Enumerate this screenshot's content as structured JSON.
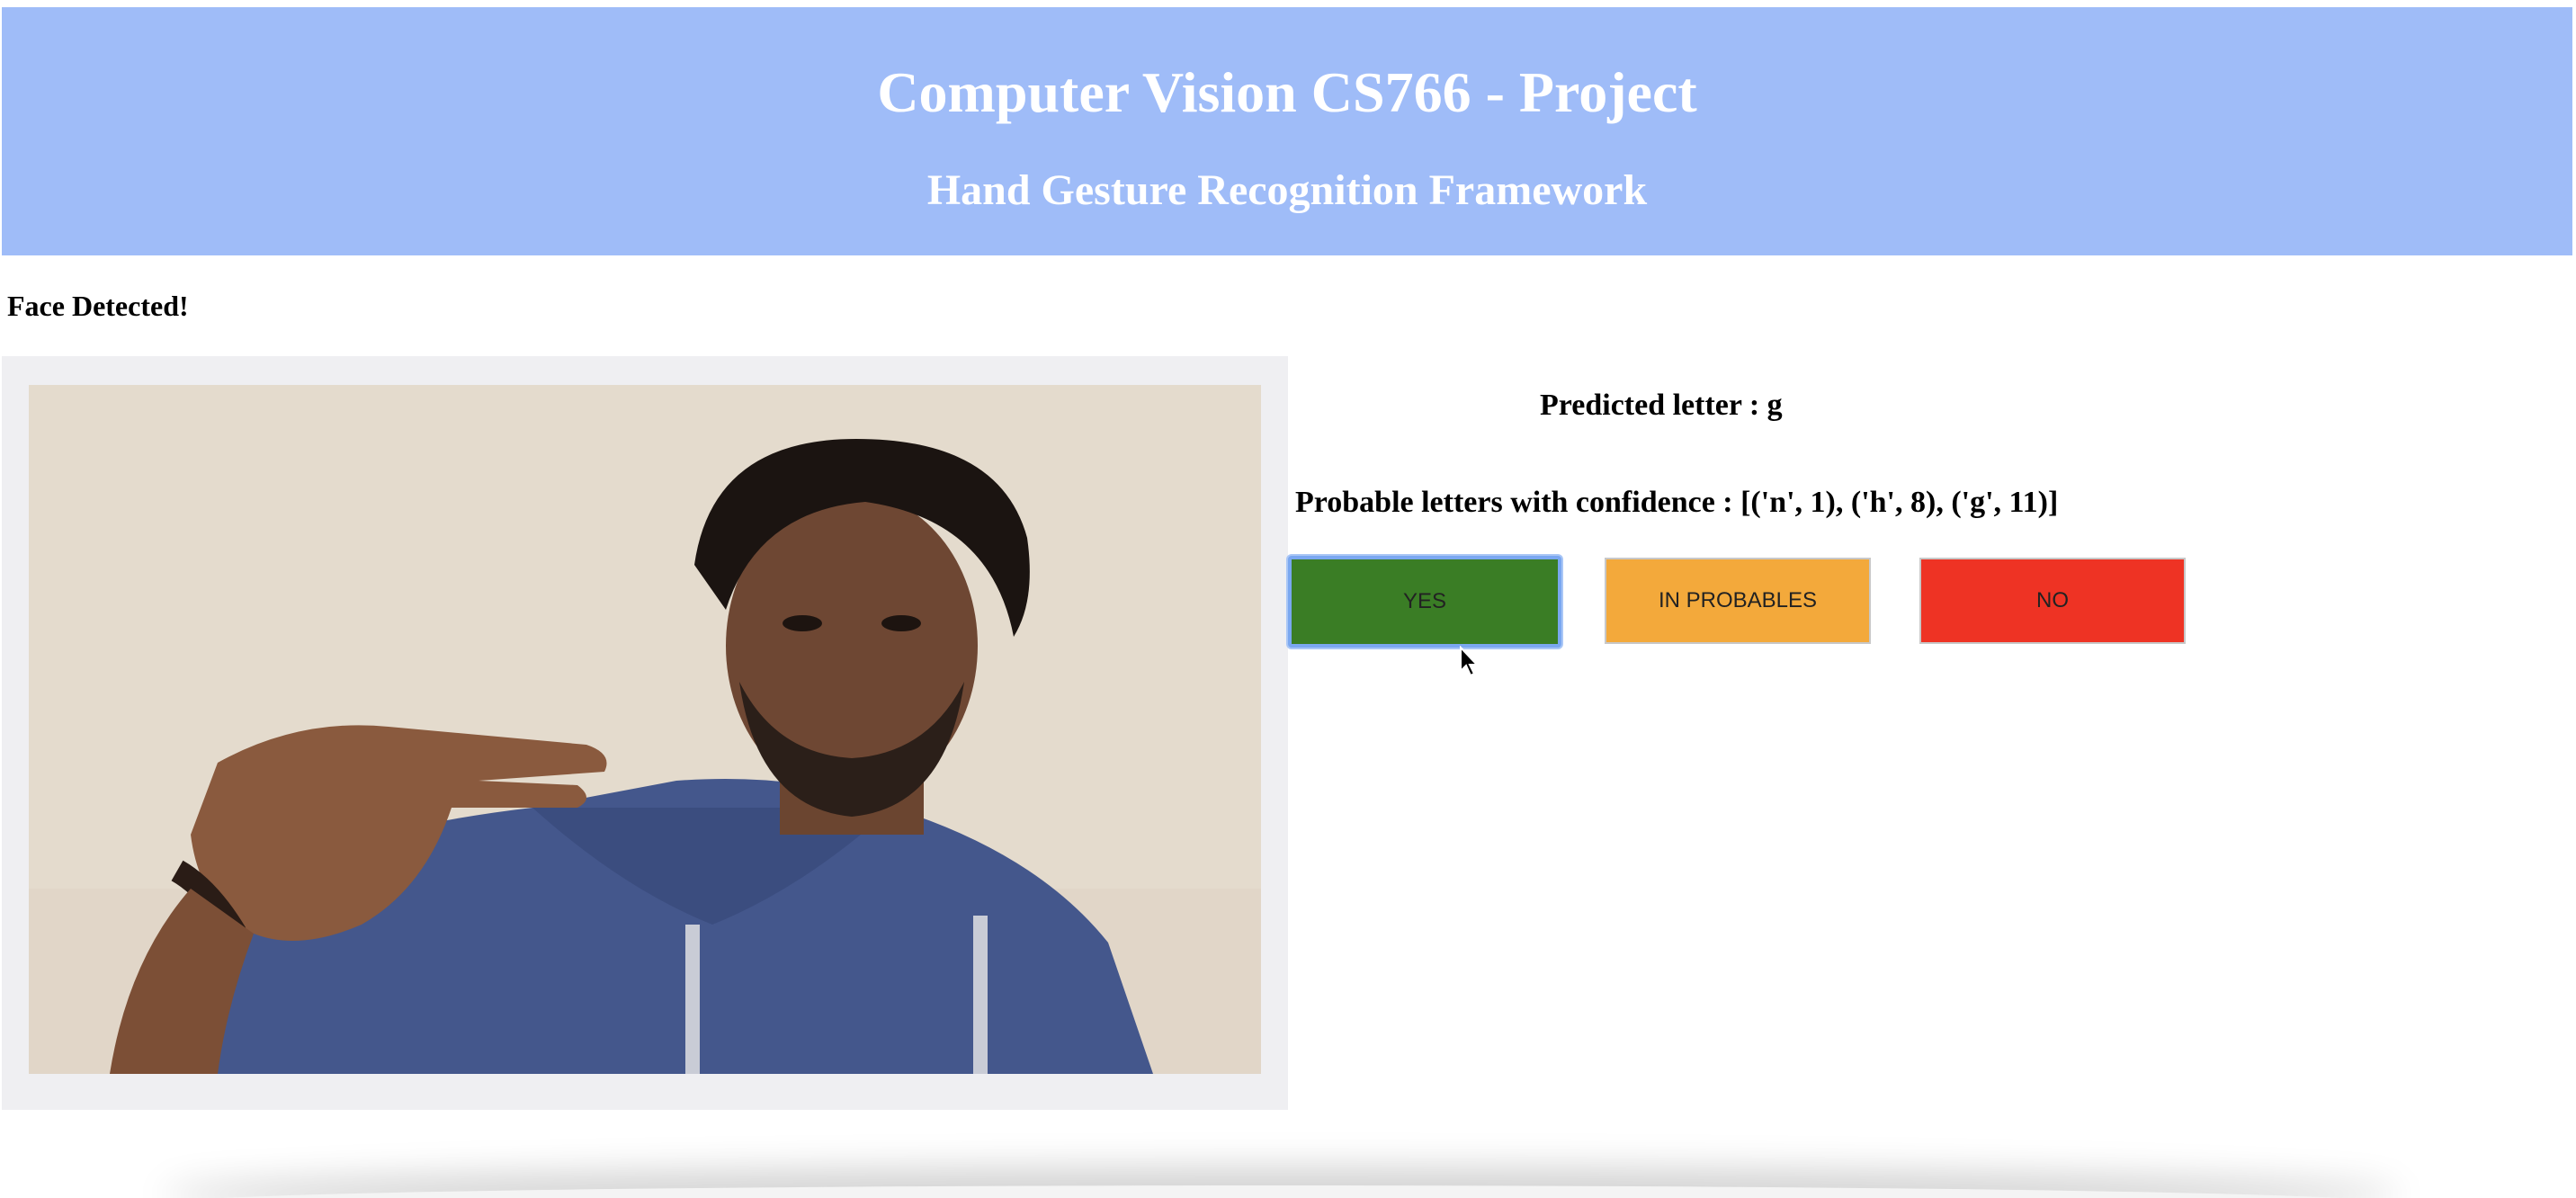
{
  "header": {
    "title": "Computer Vision CS766 - Project",
    "subtitle": "Hand Gesture Recognition Framework"
  },
  "status": {
    "message": "Face Detected!"
  },
  "prediction": {
    "predicted_text": "Predicted letter : g",
    "probable_text": "Probable letters with confidence : [('n', 1), ('h', 8), ('g', 11)]"
  },
  "buttons": {
    "yes": "YES",
    "in_probables": "IN PROBABLES",
    "no": "NO"
  },
  "colors": {
    "header_bg": "#9fbcf8",
    "yes": "#3a7d25",
    "in_probables": "#f3a93b",
    "no": "#ee3324"
  },
  "icons": {
    "video": "webcam-feed",
    "cursor": "mouse-pointer-icon"
  }
}
